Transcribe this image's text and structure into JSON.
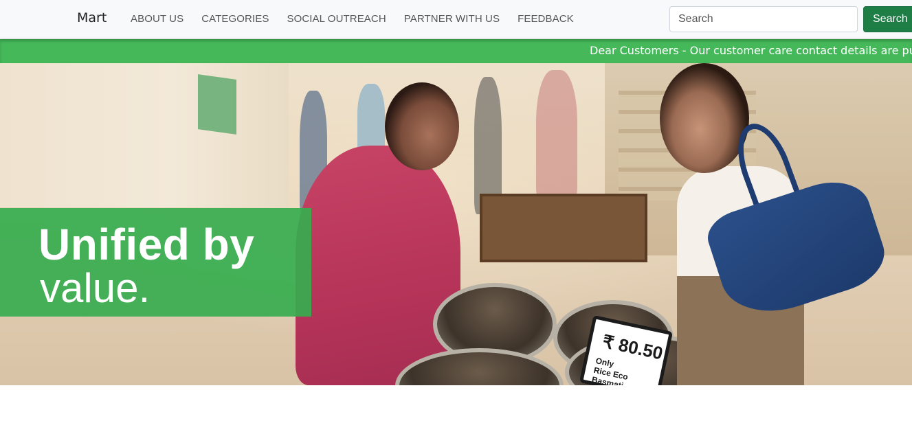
{
  "navbar": {
    "brand": "Mart",
    "links": [
      "ABOUT US",
      "CATEGORIES",
      "SOCIAL OUTREACH",
      "PARTNER WITH US",
      "FEEDBACK"
    ],
    "search": {
      "placeholder": "Search",
      "button_label": "Search"
    }
  },
  "announcement": {
    "text": "Dear Customers - Our customer care contact details are publi"
  },
  "hero": {
    "headline": "Unified by",
    "subline": "value.",
    "price_tag": {
      "price": "₹ 80.50",
      "detail_1": "Only",
      "detail_2": "Rice Eco Basmati"
    }
  },
  "colors": {
    "accent_green": "#45b85a",
    "button_green": "#1e7e46",
    "navbar_bg": "#f8f9fa"
  }
}
